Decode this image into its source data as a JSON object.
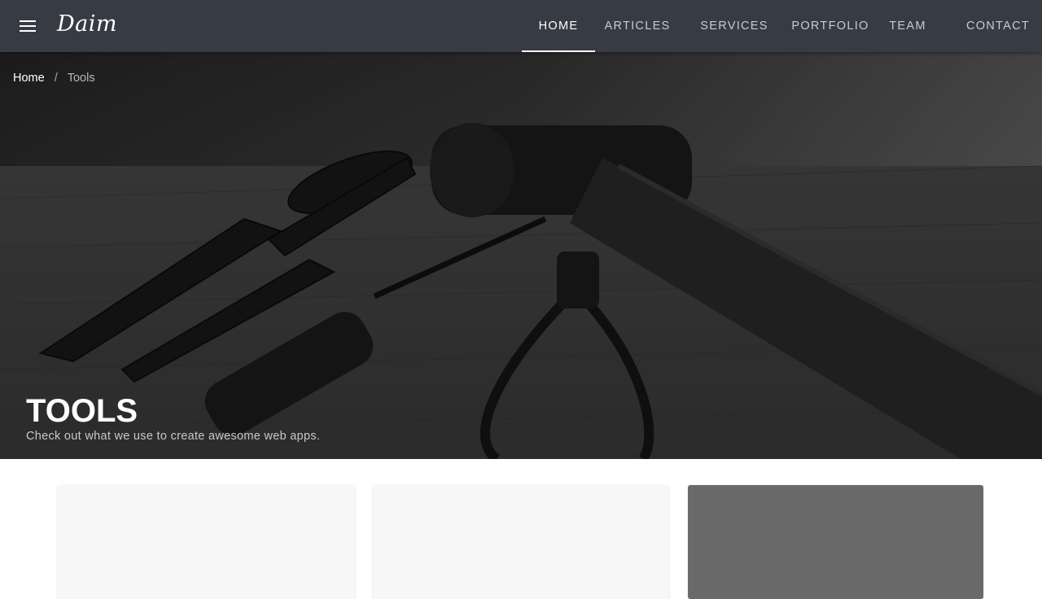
{
  "app": {
    "logo_text": "Daim"
  },
  "header": {
    "menu_icon": "hamburger-menu-icon",
    "nav": [
      {
        "label": "HOME",
        "active": true
      },
      {
        "label": "ARTICLES",
        "active": false
      },
      {
        "label": "SERVICES",
        "active": false
      },
      {
        "label": "PORTFOLIO",
        "active": false
      },
      {
        "label": "TEAM",
        "active": false
      },
      {
        "label": "CONTACT",
        "active": false
      }
    ]
  },
  "breadcrumb": {
    "home": "Home",
    "separator": "/",
    "current": "Tools"
  },
  "hero": {
    "title": "TOOLS",
    "subtitle": "Check out what we use to create awesome web apps."
  },
  "colors": {
    "topbar": "#373b43",
    "card_light": "#f7f7f7",
    "card_dark": "#6a6a6a"
  }
}
